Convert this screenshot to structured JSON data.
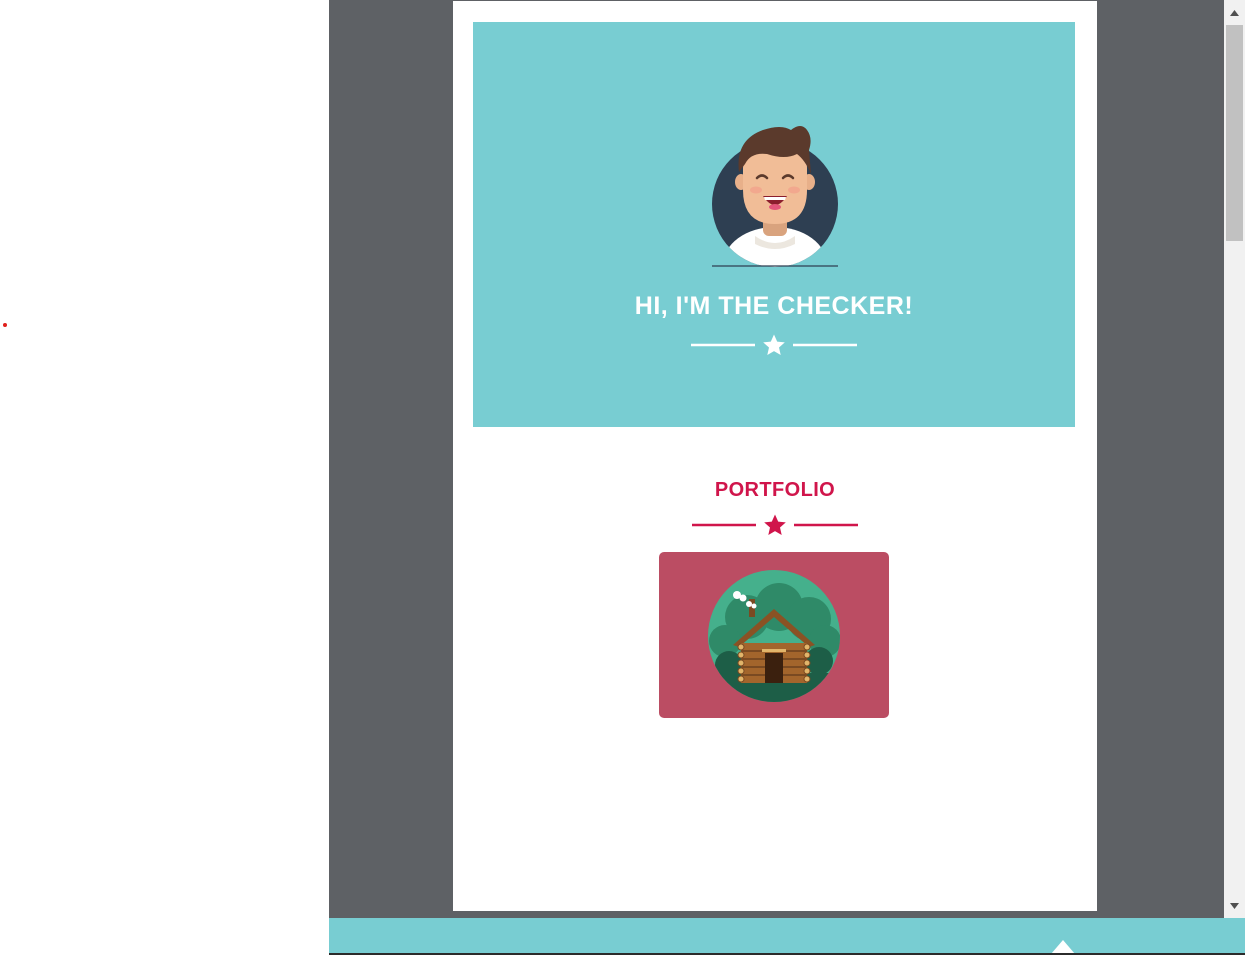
{
  "hero": {
    "title": "HI, I'M THE CHECKER!",
    "avatar_icon": "smiling-man-avatar-icon",
    "divider_icon": "star-icon",
    "background": "#78cdd2",
    "text_color": "#ffffff"
  },
  "portfolio": {
    "title": "PORTFOLIO",
    "divider_icon": "star-icon",
    "accent": "#d0154b",
    "items": [
      {
        "icon": "log-cabin-icon",
        "background": "#bb4d63"
      }
    ]
  },
  "viewer": {
    "background": "#5e6165"
  },
  "scrollbar": {
    "up_icon": "triangle-up-icon",
    "down_icon": "triangle-down-icon"
  },
  "footer": {
    "background": "#78cdd2",
    "button_icon": "chevron-up-icon"
  }
}
